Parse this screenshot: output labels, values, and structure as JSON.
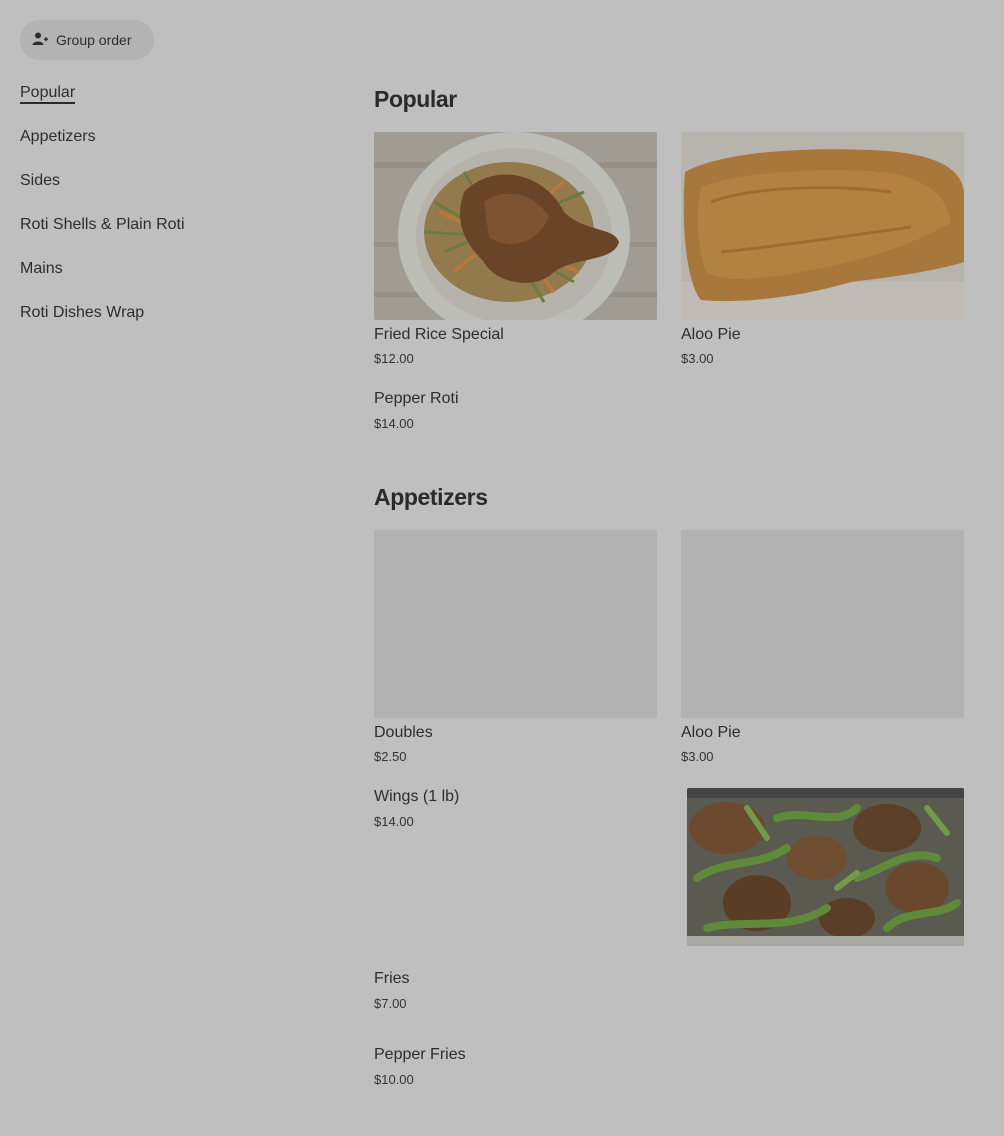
{
  "group_order": {
    "label": "Group order",
    "icon": "add-person-icon"
  },
  "sidebar": {
    "items": [
      {
        "label": "Popular",
        "active": true
      },
      {
        "label": "Appetizers"
      },
      {
        "label": "Sides"
      },
      {
        "label": "Roti Shells & Plain Roti"
      },
      {
        "label": "Mains"
      },
      {
        "label": "Roti Dishes Wrap"
      }
    ]
  },
  "popular": {
    "title": "Popular",
    "cards": [
      {
        "name": "Fried Rice Special",
        "price": "$12.00",
        "image": "fried-rice-chicken-photo"
      },
      {
        "name": "Aloo Pie",
        "price": "$3.00",
        "image": "aloo-pie-photo"
      }
    ],
    "items": [
      {
        "name": "Pepper Roti",
        "price": "$14.00"
      }
    ]
  },
  "appetizers": {
    "title": "Appetizers",
    "cards": [
      {
        "name": "Doubles",
        "price": "$2.50",
        "image": "placeholder"
      },
      {
        "name": "Aloo Pie",
        "price": "$3.00",
        "image": "placeholder"
      }
    ],
    "items": [
      {
        "name": "Wings (1 lb)",
        "price": "$14.00",
        "image": "pepper-wings-photo"
      },
      {
        "name": "Fries",
        "price": "$7.00"
      },
      {
        "name": "Pepper Fries",
        "price": "$10.00"
      }
    ]
  }
}
